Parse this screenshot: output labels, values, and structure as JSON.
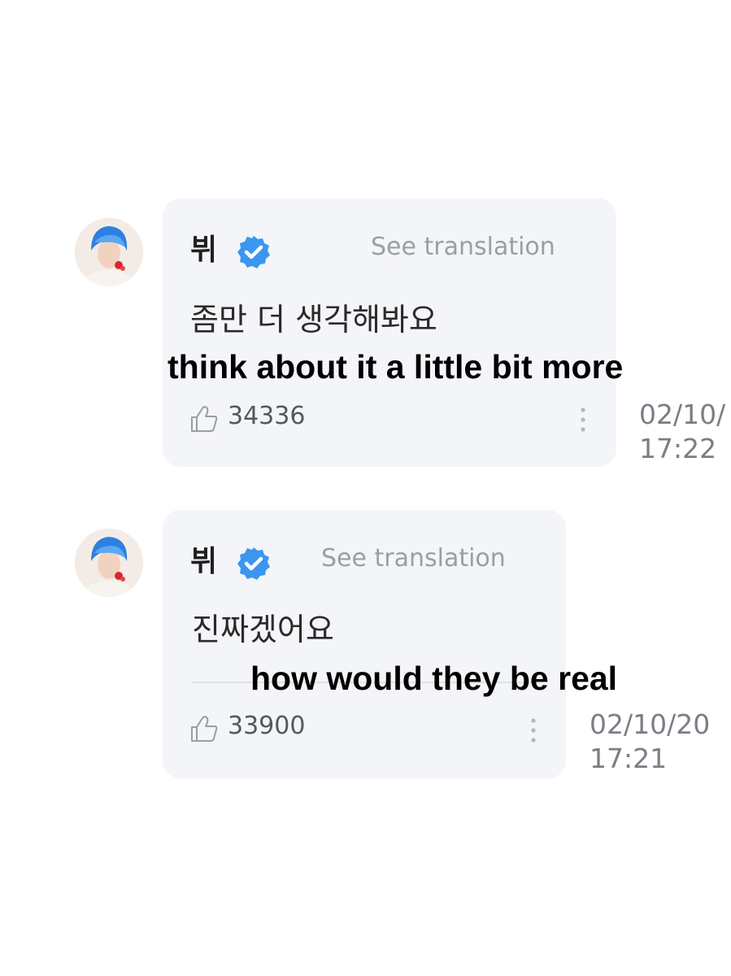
{
  "comments": [
    {
      "author": "뷔",
      "verified_icon": "verified-check-icon",
      "see_translation": "See translation",
      "text": "좀만 더 생각해봐요",
      "caption": "think about it a little bit more",
      "likes": "34336",
      "timestamp": "02/10/\n17:22"
    },
    {
      "author": "뷔",
      "verified_icon": "verified-check-icon",
      "see_translation": "See translation",
      "text": "진짜겠어요",
      "caption": "how would they be real",
      "likes": "33900",
      "timestamp": "02/10/20\n17:21"
    }
  ],
  "colors": {
    "bubble": "#f4f5f8",
    "verified": "#3b96f0",
    "muted_text": "#9b9ea6",
    "caption": "#000000",
    "avatar_hair": "#2f7fe0"
  }
}
